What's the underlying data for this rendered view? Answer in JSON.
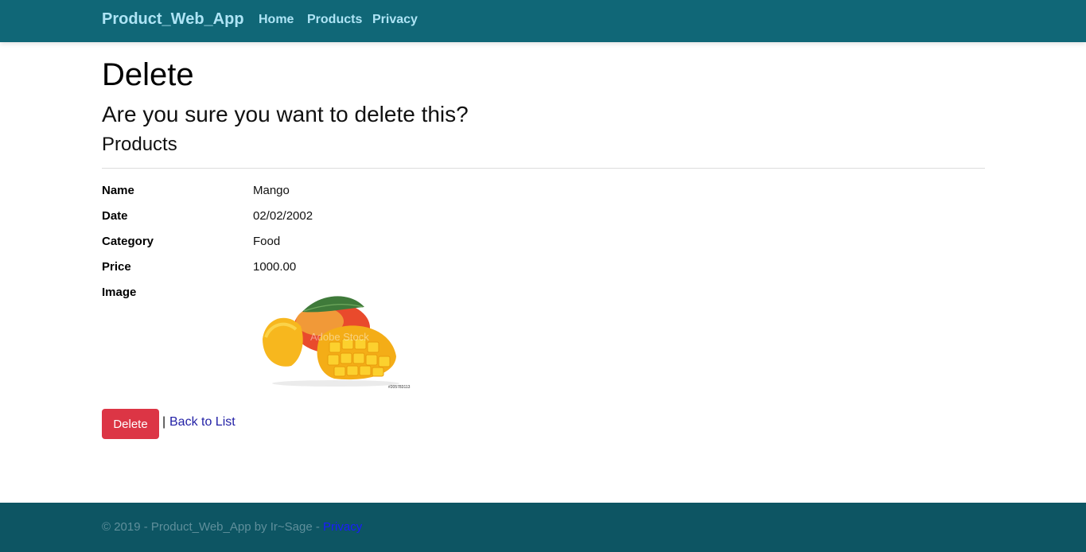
{
  "nav": {
    "brand": "Product_Web_App",
    "links": [
      "Home",
      "Products",
      "Privacy"
    ]
  },
  "page": {
    "title": "Delete",
    "confirm": "Are you sure you want to delete this?",
    "entity": "Products"
  },
  "details": [
    {
      "label": "Name",
      "value": "Mango"
    },
    {
      "label": "Date",
      "value": "02/02/2002"
    },
    {
      "label": "Category",
      "value": "Food"
    },
    {
      "label": "Price",
      "value": "1000.00"
    },
    {
      "label": "Image",
      "value": ""
    }
  ],
  "image": {
    "watermark": "Adobe Stock",
    "stock_id": "#205783113"
  },
  "actions": {
    "delete_label": "Delete",
    "separator": "|",
    "back_label": "Back to List"
  },
  "footer": {
    "text": "© 2019 - Product_Web_App by Ir~Sage - ",
    "link": "Privacy"
  },
  "colors": {
    "navbar": "#106777",
    "footer": "#0d5563",
    "danger": "#dc3545",
    "link": "#2321a6"
  }
}
